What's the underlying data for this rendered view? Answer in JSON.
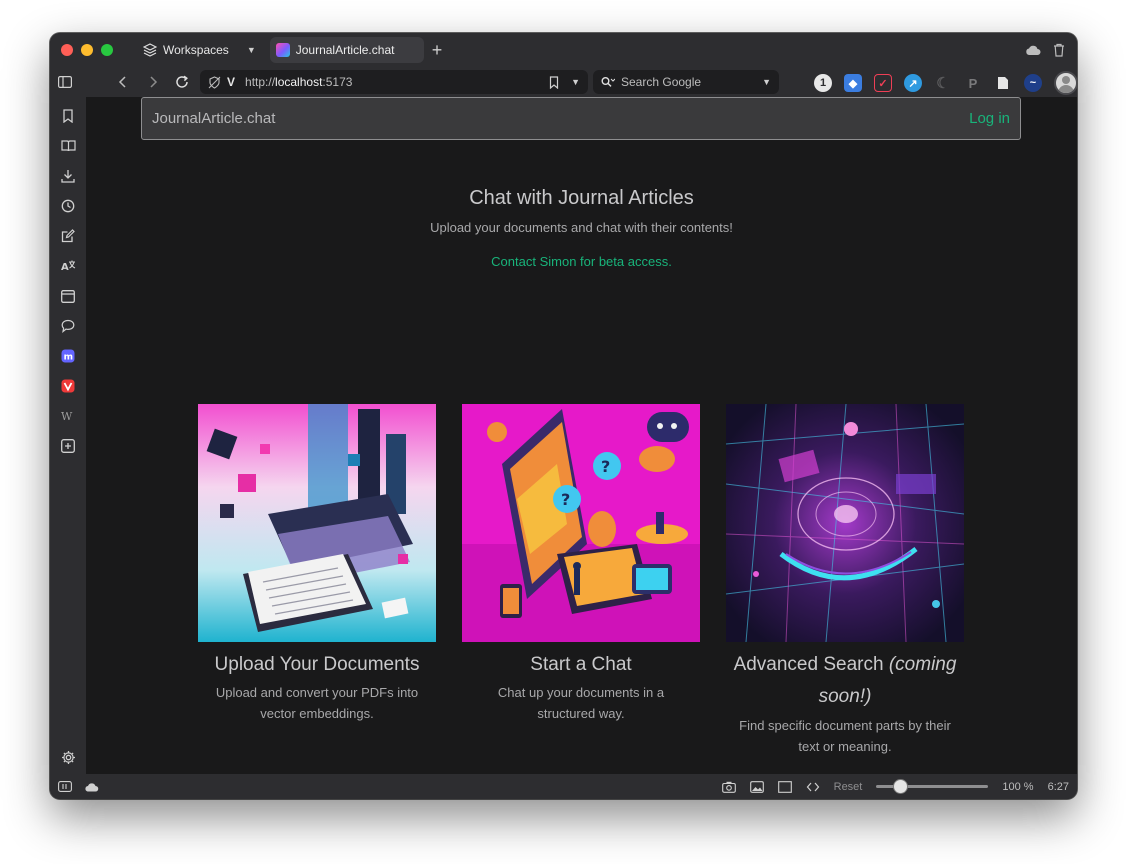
{
  "browser": {
    "workspaces_label": "Workspaces",
    "tab_title": "JournalArticle.chat",
    "url_prefix": "http://",
    "url_host": "localhost",
    "url_suffix": ":5173",
    "search_placeholder": "Search Google",
    "zoom_reset_label": "Reset",
    "zoom_level": "100 %",
    "clock": "6:27"
  },
  "navbar": {
    "brand": "JournalArticle.chat",
    "login": "Log in"
  },
  "hero": {
    "title": "Chat with Journal Articles",
    "subtitle": "Upload your documents and chat with their contents!",
    "contact": "Contact Simon for beta access."
  },
  "features": [
    {
      "title": "Upload Your Documents",
      "description": "Upload and convert your PDFs into vector embeddings."
    },
    {
      "title": "Start a Chat",
      "description": "Chat up your documents in a structured way."
    },
    {
      "title": "Advanced Search",
      "title_note": "(coming soon!)",
      "description": "Find specific document parts by their text or meaning."
    }
  ],
  "colors": {
    "accent": "#19b37a",
    "page_bg": "#19191a",
    "navbar_bg": "#3a3a3c"
  }
}
